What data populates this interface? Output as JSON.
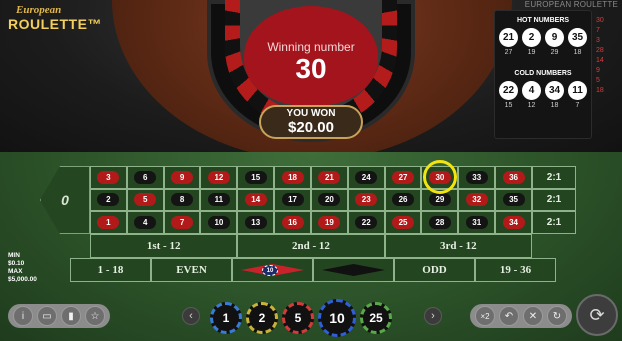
{
  "logo": {
    "line1": "European",
    "line2": "ROULETTE™"
  },
  "top_right_title": "EUROPEAN ROULETTE",
  "result": {
    "title": "Winning number",
    "number": "30",
    "won_label": "YOU WON",
    "won_amount": "$20.00"
  },
  "stats": {
    "hot_title": "HOT NUMBERS",
    "hot": [
      {
        "n": "21",
        "c": "27"
      },
      {
        "n": "2",
        "c": "19"
      },
      {
        "n": "9",
        "c": "29"
      },
      {
        "n": "35",
        "c": "18"
      }
    ],
    "cold_title": "COLD NUMBERS",
    "cold": [
      {
        "n": "22",
        "c": "15"
      },
      {
        "n": "4",
        "c": "12"
      },
      {
        "n": "34",
        "c": "18"
      },
      {
        "n": "11",
        "c": "7"
      }
    ],
    "history": [
      {
        "v": "30",
        "color": "#e03a3a"
      },
      {
        "v": "7",
        "color": "#e03a3a"
      },
      {
        "v": "3",
        "color": "#e03a3a"
      },
      {
        "v": "28",
        "color": "#e03a3a"
      },
      {
        "v": "14",
        "color": "#e03a3a"
      },
      {
        "v": "",
        "color": "#e03a3a"
      },
      {
        "v": "9",
        "color": "#e03a3a"
      },
      {
        "v": "5",
        "color": "#e03a3a"
      },
      {
        "v": "18",
        "color": "#e03a3a"
      }
    ]
  },
  "board": {
    "zero": "0",
    "rows": [
      [
        {
          "n": "3",
          "c": "red"
        },
        {
          "n": "6",
          "c": "black"
        },
        {
          "n": "9",
          "c": "red"
        },
        {
          "n": "12",
          "c": "red"
        },
        {
          "n": "15",
          "c": "black"
        },
        {
          "n": "18",
          "c": "red"
        },
        {
          "n": "21",
          "c": "red"
        },
        {
          "n": "24",
          "c": "black"
        },
        {
          "n": "27",
          "c": "red"
        },
        {
          "n": "30",
          "c": "red"
        },
        {
          "n": "33",
          "c": "black"
        },
        {
          "n": "36",
          "c": "red"
        }
      ],
      [
        {
          "n": "2",
          "c": "black"
        },
        {
          "n": "5",
          "c": "red"
        },
        {
          "n": "8",
          "c": "black"
        },
        {
          "n": "11",
          "c": "black"
        },
        {
          "n": "14",
          "c": "red"
        },
        {
          "n": "17",
          "c": "black"
        },
        {
          "n": "20",
          "c": "black"
        },
        {
          "n": "23",
          "c": "red"
        },
        {
          "n": "26",
          "c": "black"
        },
        {
          "n": "29",
          "c": "black"
        },
        {
          "n": "32",
          "c": "red"
        },
        {
          "n": "35",
          "c": "black"
        }
      ],
      [
        {
          "n": "1",
          "c": "red"
        },
        {
          "n": "4",
          "c": "black"
        },
        {
          "n": "7",
          "c": "red"
        },
        {
          "n": "10",
          "c": "black"
        },
        {
          "n": "13",
          "c": "black"
        },
        {
          "n": "16",
          "c": "red"
        },
        {
          "n": "19",
          "c": "red"
        },
        {
          "n": "22",
          "c": "black"
        },
        {
          "n": "25",
          "c": "red"
        },
        {
          "n": "28",
          "c": "black"
        },
        {
          "n": "31",
          "c": "black"
        },
        {
          "n": "34",
          "c": "red"
        }
      ]
    ],
    "columns": [
      "2:1",
      "2:1",
      "2:1"
    ],
    "dozens": [
      "1st - 12",
      "2nd - 12",
      "3rd - 12"
    ],
    "outside": [
      "1 - 18",
      "EVEN",
      "",
      "",
      "ODD",
      "19 - 36"
    ],
    "placed_chip": "10"
  },
  "limits": {
    "min_label": "MIN",
    "min": "$0.10",
    "max_label": "MAX",
    "max": "$5,000.00"
  },
  "chips": [
    {
      "v": "1",
      "color": "#3a7bd5"
    },
    {
      "v": "2",
      "color": "#c9b23a"
    },
    {
      "v": "5",
      "color": "#d33a3a"
    },
    {
      "v": "10",
      "color": "#2e5fd8"
    },
    {
      "v": "25",
      "color": "#5aa84a"
    }
  ],
  "icons": {
    "left": [
      "info-icon",
      "chat-icon",
      "stats-icon",
      "favorite-icon"
    ],
    "right": [
      "double-icon",
      "undo-icon",
      "clear-icon",
      "repeat-icon"
    ],
    "spin": "spin-icon"
  }
}
